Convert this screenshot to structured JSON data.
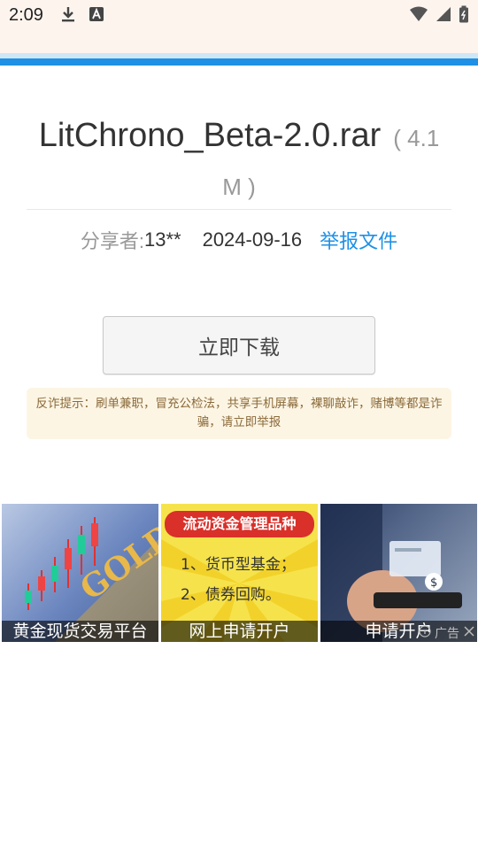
{
  "status_bar": {
    "time": "2:09",
    "icons_left": [
      "download-icon",
      "a-badge-icon"
    ],
    "icons_right": [
      "wifi-icon",
      "signal-icon",
      "battery-icon"
    ]
  },
  "file": {
    "name": "LitChrono_Beta-2.0.rar",
    "size": "( 4.1 M )"
  },
  "meta": {
    "sharer_label": "分享者:",
    "sharer": "13**",
    "date": "2024-09-16",
    "report": "举报文件"
  },
  "download_button": "立即下载",
  "notice": "反诈提示：刷单兼职，冒充公检法，共享手机屏幕，裸聊敲诈，赌博等都是诈骗，请立即举报",
  "ads": {
    "items": [
      {
        "caption": "黄金现货交易平台",
        "art_text": "GOLD"
      },
      {
        "caption": "网上申请开户",
        "title": "流动资金管理品种",
        "lines": [
          "1、货币型基金；",
          "2、债券回购。"
        ]
      },
      {
        "caption": "申请开户"
      }
    ],
    "ad_label": "广告"
  },
  "colors": {
    "accent": "#1e90e6",
    "status_bg": "#fdf4ee",
    "notice_bg": "#fdf5e4"
  }
}
